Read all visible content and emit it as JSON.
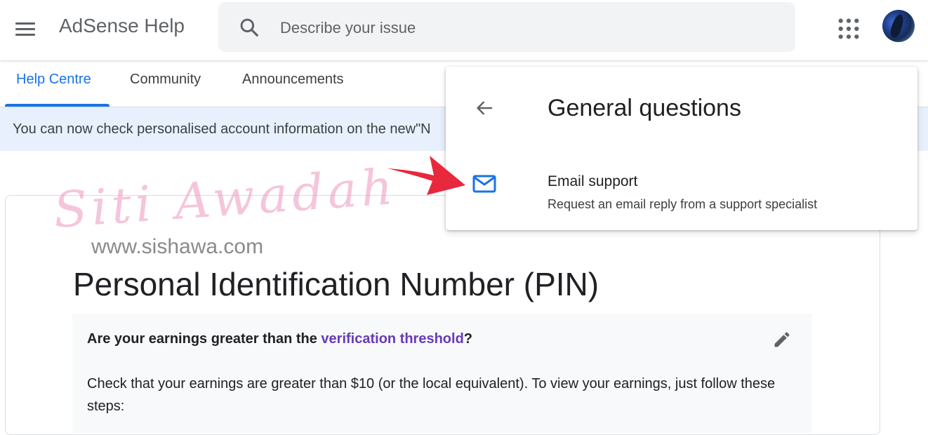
{
  "header": {
    "title": "AdSense Help",
    "search_placeholder": "Describe your issue",
    "icons": [
      "menu-icon",
      "search-icon",
      "apps-grid-icon",
      "avatar"
    ]
  },
  "tabs": [
    {
      "label": "Help Centre",
      "active": true
    },
    {
      "label": "Community",
      "active": false
    },
    {
      "label": "Announcements",
      "active": false
    }
  ],
  "banner": {
    "text": "You can now check personalised account information on the new\"N"
  },
  "article": {
    "title": "Personal Identification Number (PIN)",
    "question_prefix": "Are your earnings greater than the ",
    "question_link": "verification threshold",
    "question_suffix": "?",
    "body": "Check that your earnings are greater than $10 (or the local equivalent). To view your earnings, just follow these steps:"
  },
  "popup": {
    "title": "General questions",
    "option": {
      "title": "Email support",
      "description": "Request an email reply from a support specialist"
    }
  },
  "watermark": {
    "script": "Siti Awadah",
    "url": "www.sishawa.com"
  },
  "colors": {
    "accent": "#1a73e8",
    "link": "#673ab7",
    "banner_bg": "#e8f0fe",
    "arrow": "#e8283c",
    "watermark": "#ec96be"
  }
}
